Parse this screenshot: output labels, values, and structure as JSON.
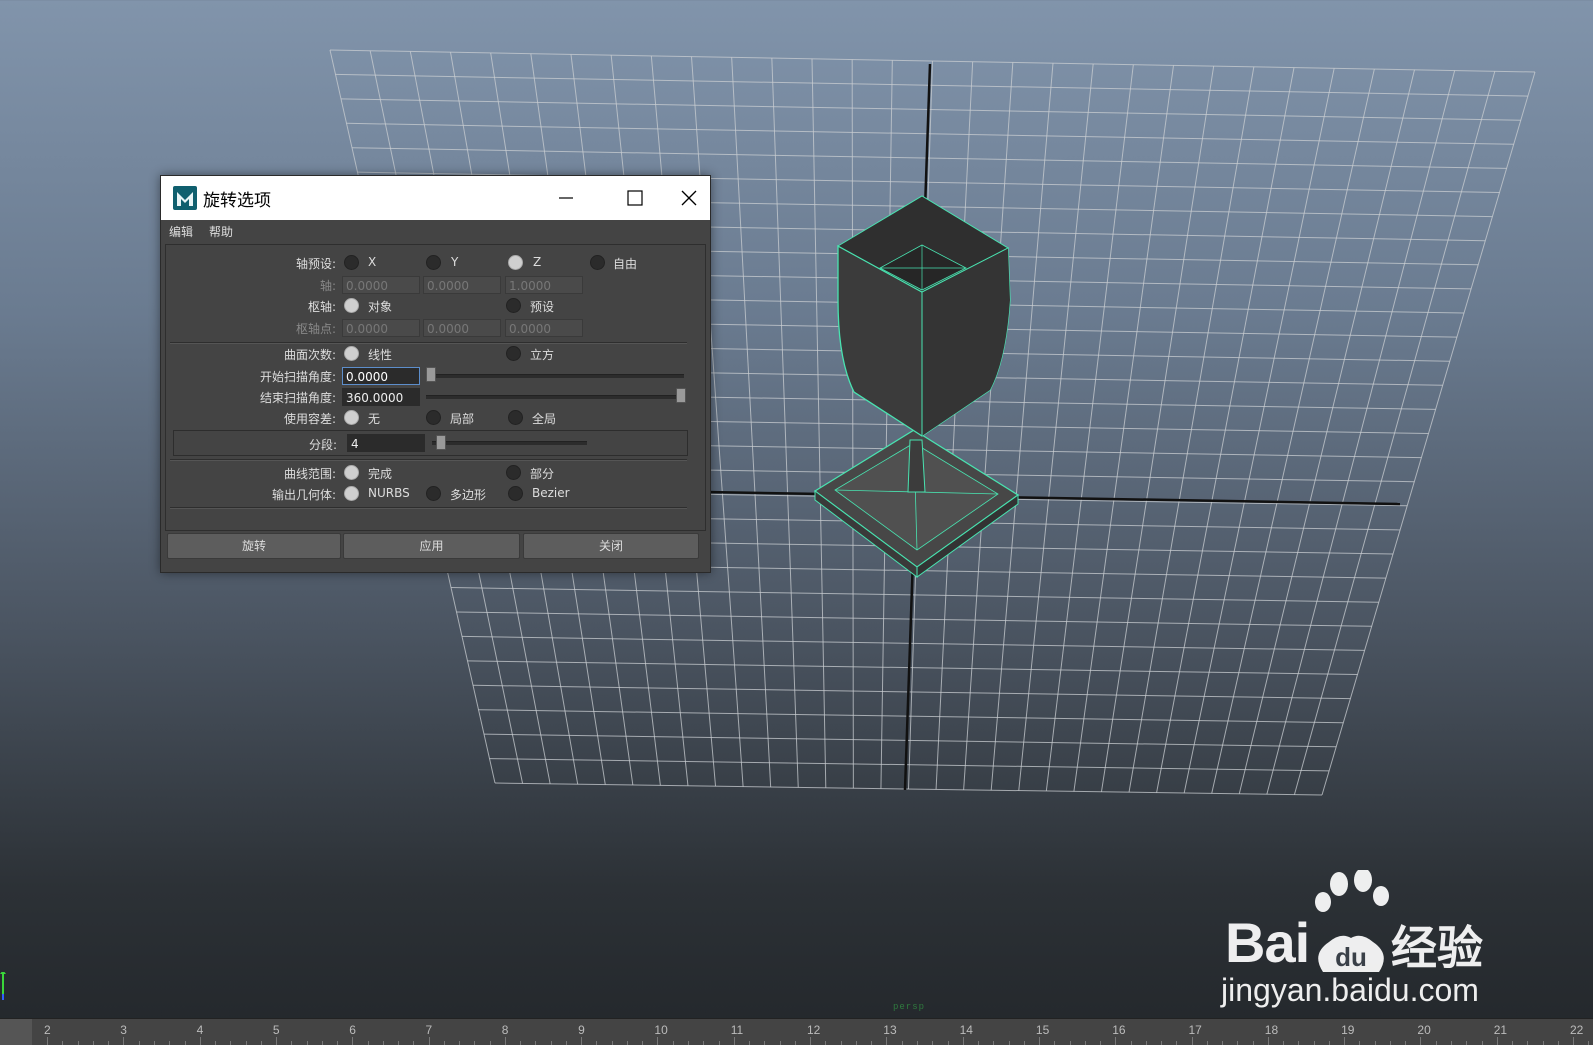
{
  "dialog": {
    "title": "旋转选项",
    "menu": [
      "编辑",
      "帮助"
    ],
    "axis_preset": {
      "label": "轴预设:",
      "options": [
        "X",
        "Y",
        "Z",
        "自由"
      ],
      "selected": "Z"
    },
    "axis": {
      "label": "轴:",
      "values": [
        "0.0000",
        "0.0000",
        "1.0000"
      ]
    },
    "pivot": {
      "label": "枢轴:",
      "options": [
        "对象",
        "预设"
      ],
      "selected": "对象"
    },
    "pivot_point": {
      "label": "枢轴点:",
      "values": [
        "0.0000",
        "0.0000",
        "0.0000"
      ]
    },
    "surface_degree": {
      "label": "曲面次数:",
      "options": [
        "线性",
        "立方"
      ],
      "selected": "线性"
    },
    "start_sweep": {
      "label": "开始扫描角度:",
      "value": "0.0000",
      "slider_fraction": 0.0
    },
    "end_sweep": {
      "label": "结束扫描角度:",
      "value": "360.0000",
      "slider_fraction": 1.0
    },
    "use_tolerance": {
      "label": "使用容差:",
      "options": [
        "无",
        "局部",
        "全局"
      ],
      "selected": "无"
    },
    "segments": {
      "label": "分段:",
      "value": "4"
    },
    "curve_range": {
      "label": "曲线范围:",
      "options": [
        "完成",
        "部分"
      ],
      "selected": "完成"
    },
    "output_geometry": {
      "label": "输出几何体:",
      "options": [
        "NURBS",
        "多边形",
        "Bezier"
      ],
      "selected": "NURBS"
    },
    "buttons": {
      "revolve": "旋转",
      "apply": "应用",
      "close": "关闭"
    }
  },
  "viewport": {
    "camera_label": "persp",
    "selection_color": "#49e3b0"
  },
  "timeline": {
    "ticks": [
      "2",
      "3",
      "4",
      "5",
      "6",
      "7",
      "8",
      "9",
      "10",
      "11",
      "12",
      "13",
      "14",
      "15",
      "16",
      "17",
      "18",
      "19",
      "20",
      "21",
      "22"
    ]
  },
  "watermark": {
    "brand": "Bai",
    "brand_suffix": "经验",
    "url": "jingyan.baidu.com"
  },
  "icons": {
    "app": "maya-app-icon",
    "minimize": "minimize-icon",
    "maximize": "maximize-icon",
    "close": "close-icon"
  }
}
